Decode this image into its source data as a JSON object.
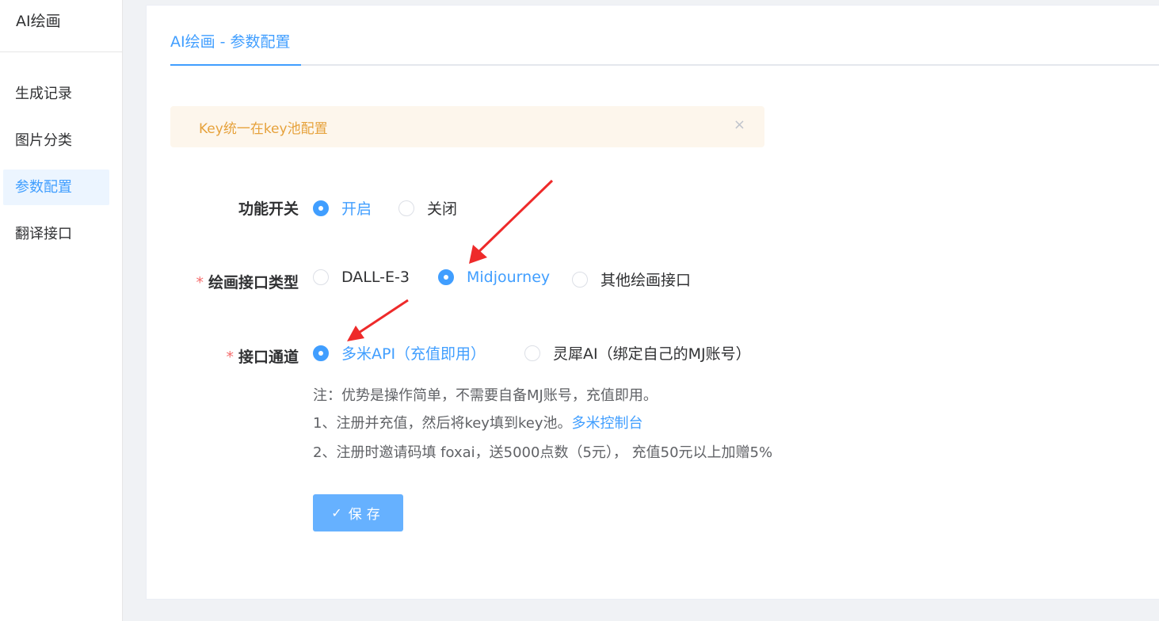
{
  "sidebar": {
    "title": "AI绘画",
    "items": [
      {
        "label": "生成记录"
      },
      {
        "label": "图片分类"
      },
      {
        "label": "参数配置"
      },
      {
        "label": "翻译接口"
      }
    ]
  },
  "tabs": [
    {
      "label": "AI绘画 - 参数配置"
    }
  ],
  "alert": {
    "text": "Key统一在key池配置",
    "close": "×"
  },
  "form": {
    "feature_switch": {
      "label": "功能开关",
      "options": [
        {
          "label": "开启",
          "checked": true
        },
        {
          "label": "关闭",
          "checked": false
        }
      ]
    },
    "draw_api_type": {
      "label": "绘画接口类型",
      "required": "*",
      "options": [
        {
          "label": "DALL-E-3",
          "checked": false
        },
        {
          "label": "Midjourney",
          "checked": true
        },
        {
          "label": "其他绘画接口",
          "checked": false
        }
      ]
    },
    "api_channel": {
      "label": "接口通道",
      "required": "*",
      "options": [
        {
          "label": "多米API（充值即用）",
          "checked": true
        },
        {
          "label": "灵犀AI（绑定自己的MJ账号）",
          "checked": false
        }
      ]
    }
  },
  "notes": {
    "line1": "注：优势是操作简单，不需要自备MJ账号，充值即用。",
    "line2_prefix": "1、注册并充值，然后将key填到key池。",
    "line2_link": "多米控制台",
    "line3": "2、注册时邀请码填 foxai，送5000点数（5元），  充值50元以上加赠5%"
  },
  "save_button": {
    "label": "保存"
  },
  "colors": {
    "primary": "#409eff",
    "button": "#66b1ff",
    "warning": "#e6a23c",
    "danger": "#f56c6c",
    "annotation_arrow": "#ee2a2a"
  },
  "icons": {
    "save": "check-icon",
    "alert_close": "close-icon",
    "annotation": "red-arrow"
  }
}
